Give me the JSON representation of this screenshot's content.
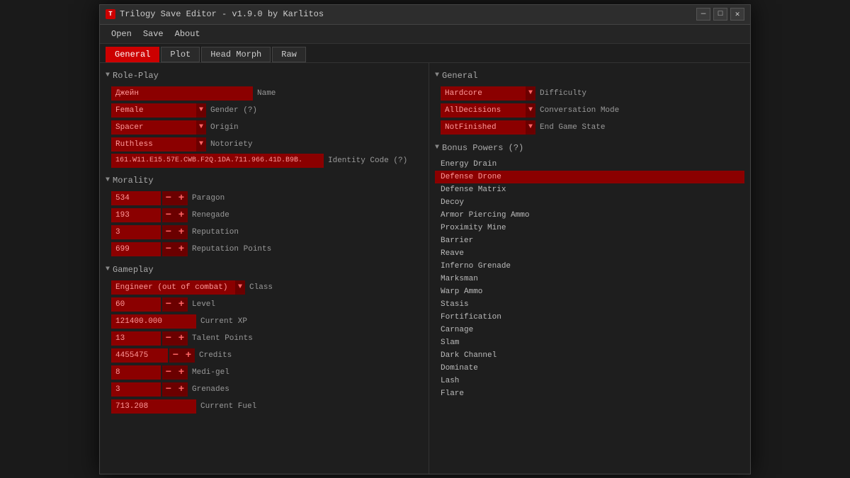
{
  "window": {
    "title": "Trilogy Save Editor - v1.9.0 by Karlitos",
    "icon_label": "T",
    "controls": {
      "minimize": "—",
      "maximize": "□",
      "close": "✕"
    }
  },
  "menu": {
    "items": [
      "Open",
      "Save",
      "About"
    ]
  },
  "tabs": [
    {
      "label": "General",
      "active": true
    },
    {
      "label": "Plot",
      "active": false
    },
    {
      "label": "Head Morph",
      "active": false
    },
    {
      "label": "Raw",
      "active": false
    }
  ],
  "left_panel": {
    "roleplay_section": {
      "header": "Role-Play",
      "name_value": "Джейн",
      "name_label": "Name",
      "gender_value": "Female",
      "gender_label": "Gender (?)",
      "origin_value": "Spacer",
      "origin_label": "Origin",
      "notoriety_value": "Ruthless",
      "notoriety_label": "Notoriety",
      "identity_value": "161.W11.E15.57E.CWB.F2Q.1DA.711.966.41D.B9B.",
      "identity_label": "Identity Code (?)"
    },
    "morality_section": {
      "header": "Morality",
      "paragon_value": "534",
      "paragon_label": "Paragon",
      "renegade_value": "193",
      "renegade_label": "Renegade",
      "reputation_value": "3",
      "reputation_label": "Reputation",
      "rep_points_value": "699",
      "rep_points_label": "Reputation Points"
    },
    "gameplay_section": {
      "header": "Gameplay",
      "class_value": "Engineer (out of combat)",
      "class_label": "Class",
      "level_value": "60",
      "level_label": "Level",
      "xp_value": "121400.000",
      "xp_label": "Current XP",
      "talent_value": "13",
      "talent_label": "Talent Points",
      "credits_value": "4455475",
      "credits_label": "Credits",
      "medigel_value": "8",
      "medigel_label": "Medi-gel",
      "grenades_value": "3",
      "grenades_label": "Grenades",
      "fuel_value": "713.208",
      "fuel_label": "Current Fuel"
    }
  },
  "right_panel": {
    "general_section": {
      "header": "General",
      "difficulty_value": "Hardcore",
      "difficulty_label": "Difficulty",
      "conversation_value": "AllDecisions",
      "conversation_label": "Conversation Mode",
      "endgame_value": "NotFinished",
      "endgame_label": "End Game State"
    },
    "bonus_powers_section": {
      "header": "Bonus Powers (?)",
      "items": [
        {
          "label": "Energy Drain",
          "selected": false
        },
        {
          "label": "Defense Drone",
          "selected": true
        },
        {
          "label": "Defense Matrix",
          "selected": false
        },
        {
          "label": "Decoy",
          "selected": false
        },
        {
          "label": "Armor Piercing Ammo",
          "selected": false
        },
        {
          "label": "Proximity Mine",
          "selected": false
        },
        {
          "label": "Barrier",
          "selected": false
        },
        {
          "label": "Reave",
          "selected": false
        },
        {
          "label": "Inferno Grenade",
          "selected": false
        },
        {
          "label": "Marksman",
          "selected": false
        },
        {
          "label": "Warp Ammo",
          "selected": false
        },
        {
          "label": "Stasis",
          "selected": false
        },
        {
          "label": "Fortification",
          "selected": false
        },
        {
          "label": "Carnage",
          "selected": false
        },
        {
          "label": "Slam",
          "selected": false
        },
        {
          "label": "Dark Channel",
          "selected": false
        },
        {
          "label": "Dominate",
          "selected": false
        },
        {
          "label": "Lash",
          "selected": false
        },
        {
          "label": "Flare",
          "selected": false
        }
      ]
    }
  }
}
